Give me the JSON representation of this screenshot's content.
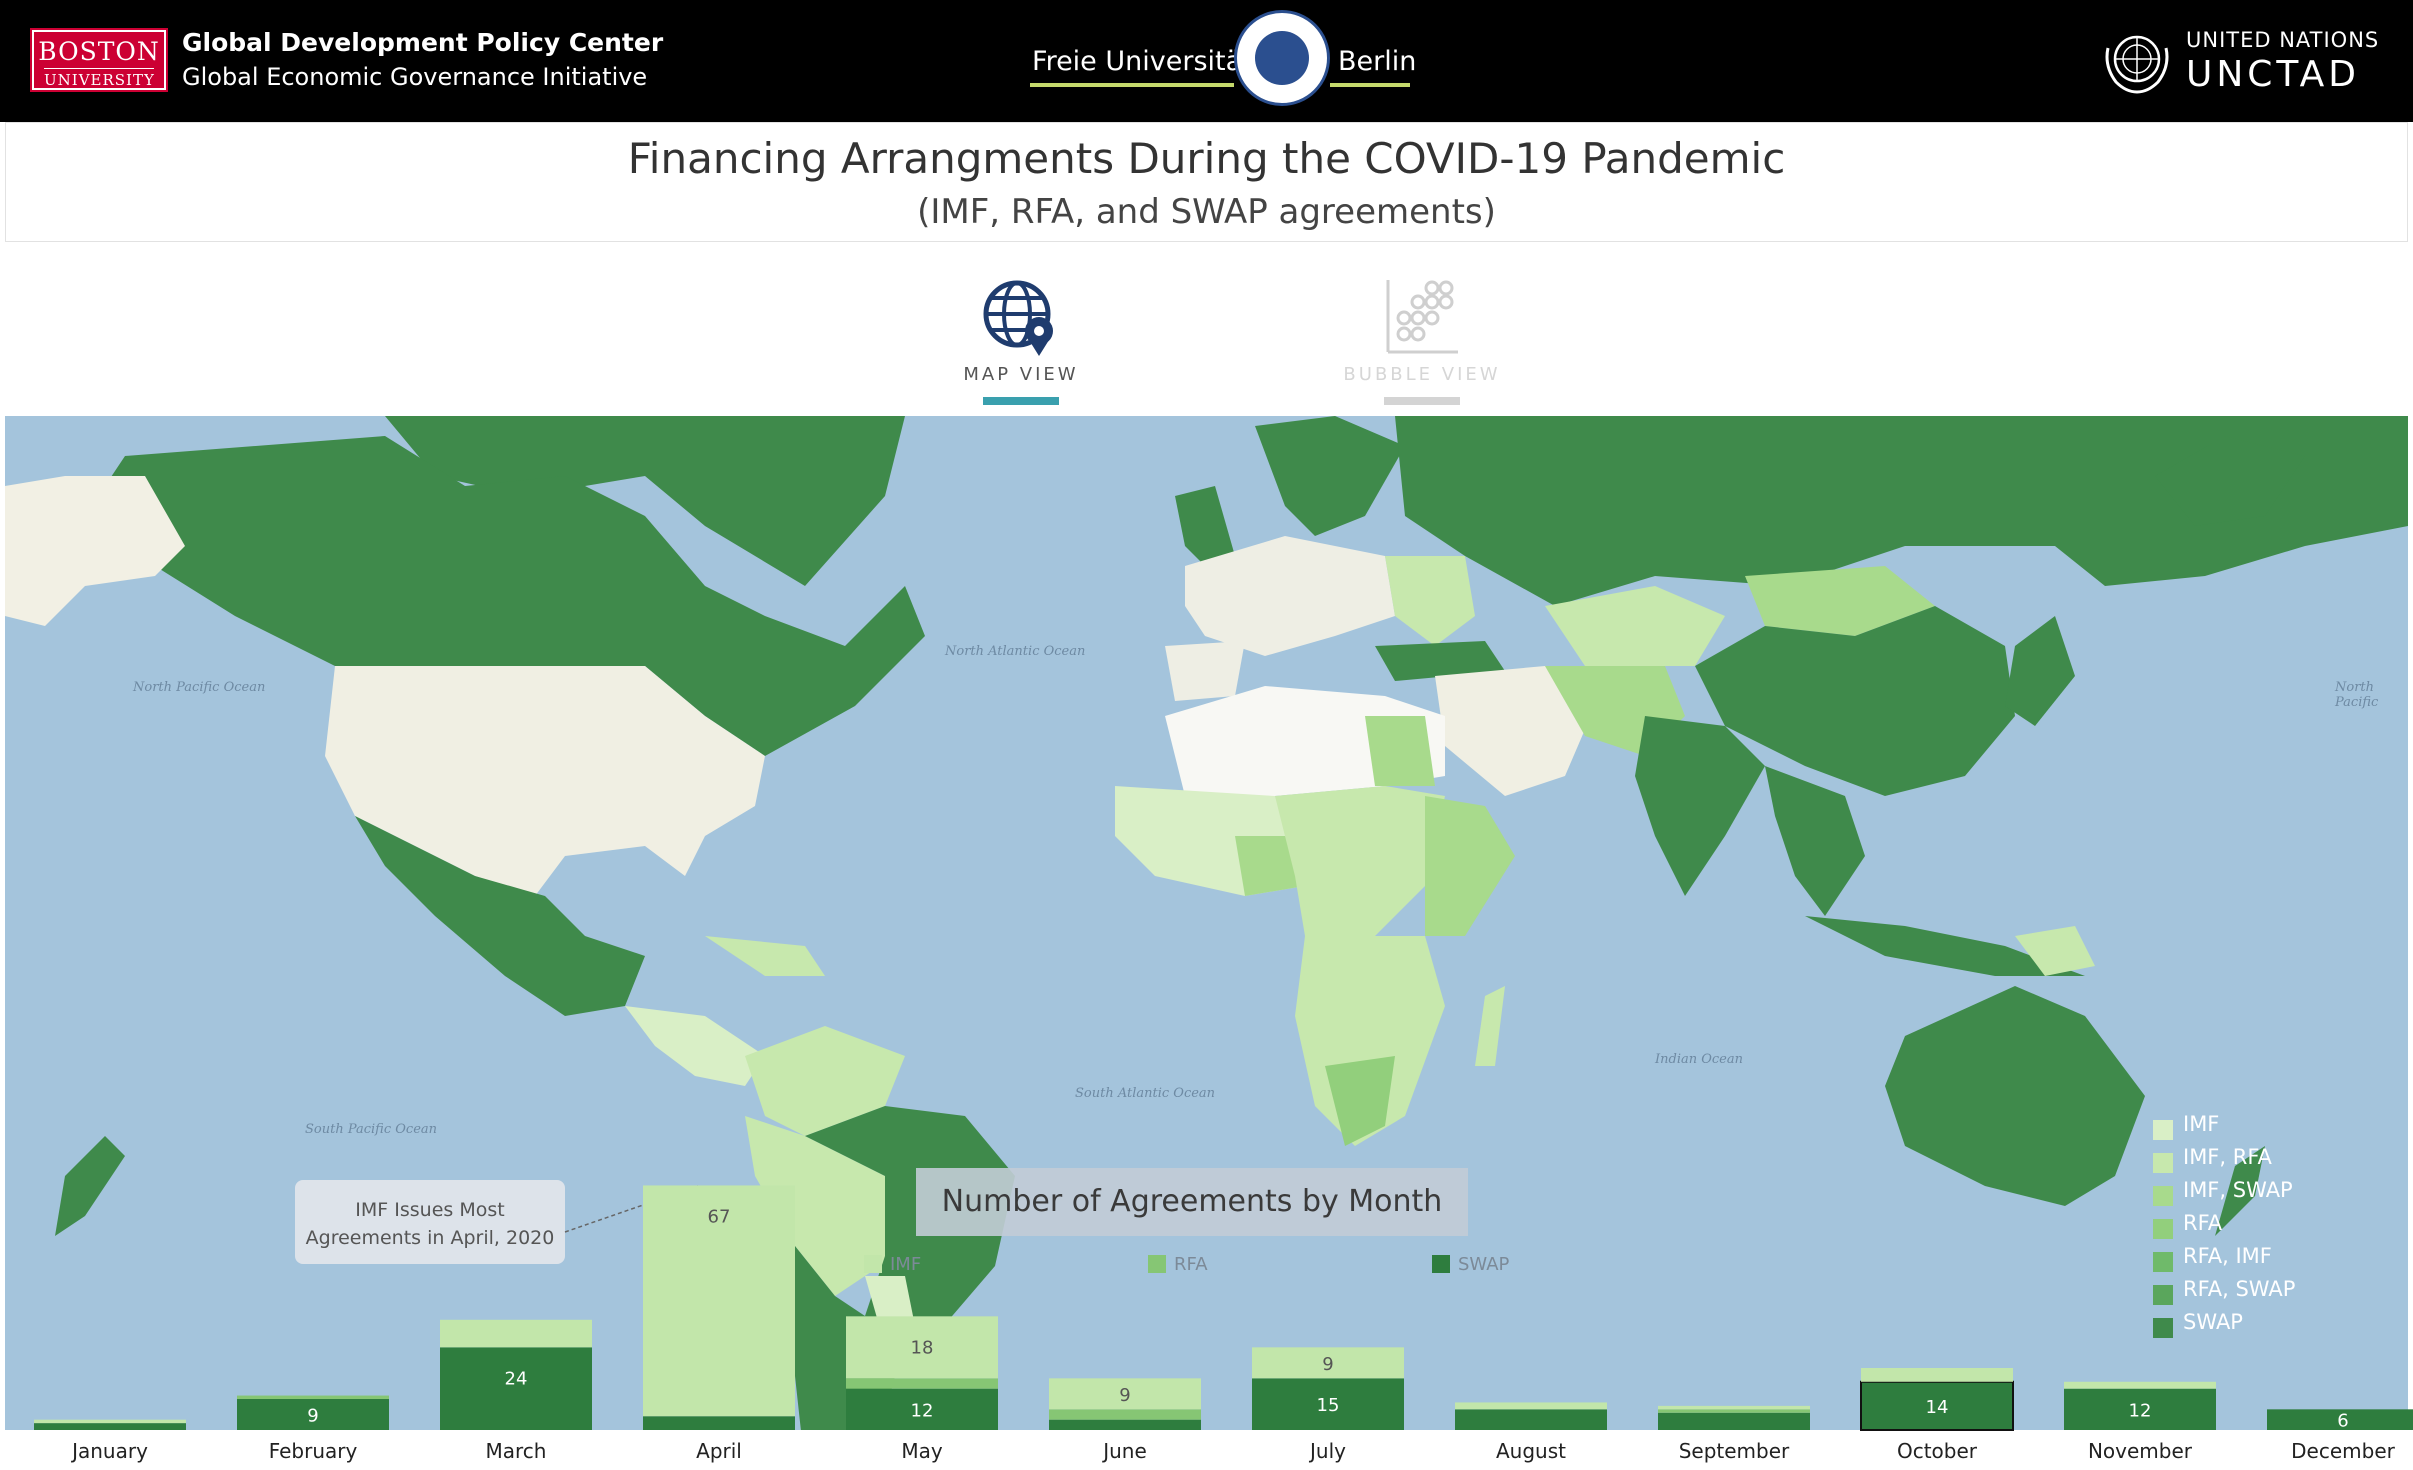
{
  "header": {
    "bu_logo_line1": "BOSTON",
    "bu_logo_line2": "UNIVERSITY",
    "bu_center": "Global Development Policy Center",
    "bu_initiative": "Global Economic Governance Initiative",
    "fu_word1": "Freie Universität",
    "fu_word2": "Berlin",
    "un_line1": "UNITED NATIONS",
    "un_line2": "UNCTAD",
    "accent_colors": {
      "bu_red": "#cc0033",
      "fu_green": "#c5d96b",
      "fu_blue": "#2b4f8f"
    }
  },
  "title": "Financing Arrangments During the COVID-19 Pandemic",
  "subtitle": "(IMF, RFA, and SWAP agreements)",
  "views": {
    "map": {
      "label": "MAP VIEW",
      "icon": "globe-pin-icon",
      "active": true
    },
    "bubble": {
      "label": "BUBBLE VIEW",
      "icon": "bubble-grid-icon",
      "active": false
    }
  },
  "map": {
    "legend": [
      {
        "label": "IMF",
        "color": "#d9efc6"
      },
      {
        "label": "IMF, RFA",
        "color": "#c7e8ad"
      },
      {
        "label": "IMF, SWAP",
        "color": "#a8da8c"
      },
      {
        "label": "RFA",
        "color": "#92cf7c"
      },
      {
        "label": "RFA, IMF",
        "color": "#6fba6a"
      },
      {
        "label": "RFA, SWAP",
        "color": "#5aa65c"
      },
      {
        "label": "SWAP",
        "color": "#3f8a4b"
      }
    ],
    "ocean_labels": {
      "north_pacific_left": "North Pacific Ocean",
      "north_atlantic": "North Atlantic Ocean",
      "north_pacific_right": "North Pacific",
      "south_atlantic": "South Atlantic Ocean",
      "south_pacific": "South Pacific Ocean",
      "indian": "Indian Ocean"
    }
  },
  "annotation": {
    "line1": "IMF Issues Most",
    "line2": "Agreements in April, 2020"
  },
  "chart_data": {
    "type": "bar",
    "title": "Number of Agreements by Month",
    "stacked": true,
    "categories": [
      "January",
      "February",
      "March",
      "April",
      "May",
      "June",
      "July",
      "August",
      "September",
      "October",
      "November",
      "December"
    ],
    "series": [
      {
        "name": "SWAP",
        "color": "#2e7d3e",
        "values": [
          2,
          9,
          24,
          4,
          12,
          3,
          15,
          6,
          5,
          14,
          12,
          6
        ]
      },
      {
        "name": "RFA",
        "color": "#86c674",
        "values": [
          0,
          1,
          0,
          0,
          3,
          3,
          0,
          0,
          1,
          0,
          0,
          0
        ]
      },
      {
        "name": "IMF",
        "color": "#c2e6aa",
        "values": [
          1,
          0,
          8,
          67,
          18,
          9,
          9,
          2,
          1,
          4,
          2,
          0
        ]
      }
    ],
    "bar_labels": {
      "SWAP": [
        "",
        "9",
        "24",
        "",
        "12",
        "",
        "15",
        "",
        "",
        "14",
        "12",
        "6"
      ],
      "RFA": [
        "",
        "",
        "",
        "",
        "",
        "",
        "",
        "",
        "",
        "",
        "",
        ""
      ],
      "IMF": [
        "",
        "",
        "",
        "67",
        "18",
        "9",
        "9",
        "",
        "",
        "",
        "",
        ""
      ]
    },
    "ylim": [
      0,
      72
    ],
    "highlighted_category": "October"
  }
}
